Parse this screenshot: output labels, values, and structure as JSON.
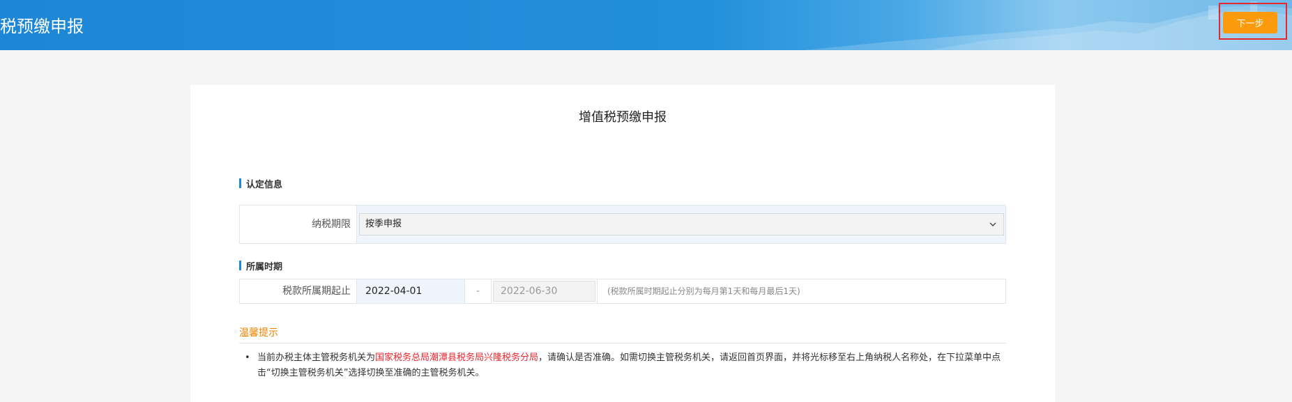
{
  "header": {
    "title": "税预缴申报",
    "next_button": "下一步"
  },
  "form": {
    "title": "增值税预缴申报",
    "section_identify": "认定信息",
    "tax_period_label": "纳税期限",
    "tax_period_value": "按季申报",
    "section_period": "所属时期",
    "period_label": "税款所属期起止",
    "period_start": "2022-04-01",
    "period_separator": "-",
    "period_end": "2022-06-30",
    "period_hint": "(税款所属时期起止分别为每月第1天和每月最后1天)"
  },
  "tips": {
    "title": "温馨提示",
    "bullet": "•",
    "text_before": "当前办税主体主管税务机关为",
    "authority": "国家税务总局潮潭县税务局兴隆税务分局",
    "text_after": "，请确认是否准确。如需切换主管税务机关，请返回首页界面，并将光标移至右上角纳税人名称处，在下拉菜单中点击“切换主管税务机关”选择切换至准确的主管税务机关。"
  },
  "colors": {
    "header_blue": "#2390db",
    "next_button": "#fb9a0a",
    "highlight_frame": "#e8262d",
    "accent_bar": "#1e88e5",
    "tip_title": "#f08200",
    "authority_text": "#e8262d"
  },
  "icons": {
    "select_chevron": "chevron-down-icon"
  }
}
